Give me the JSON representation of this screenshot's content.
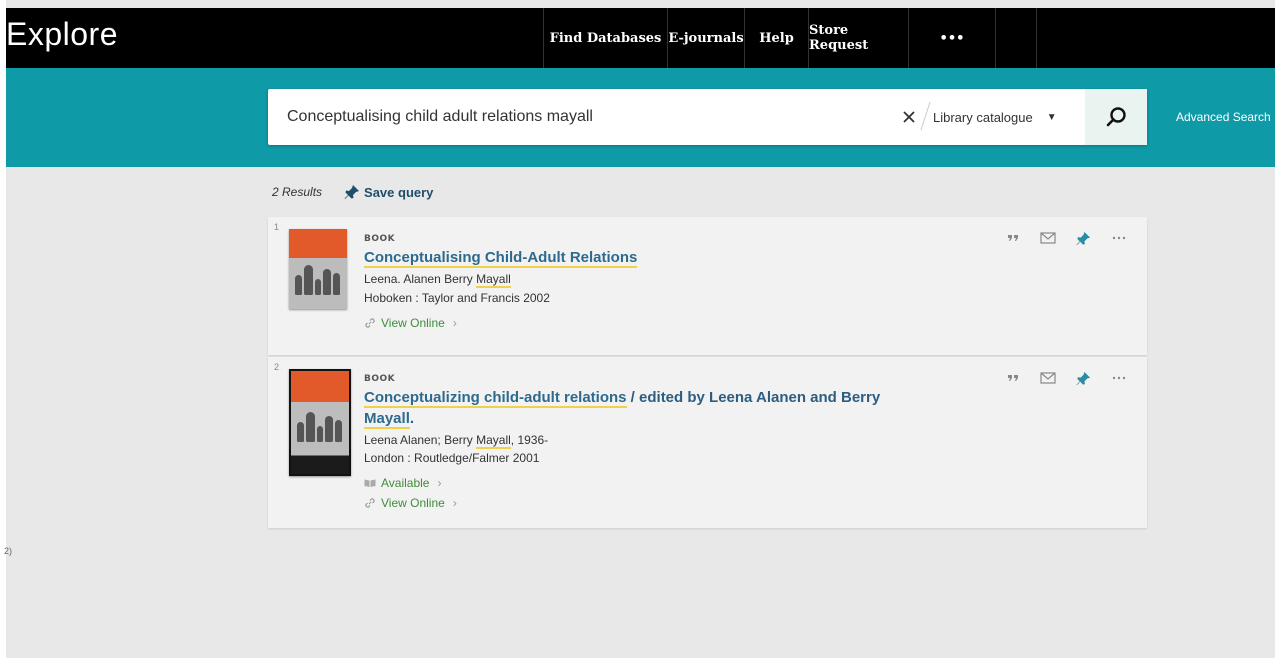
{
  "header": {
    "brand": "Explore",
    "nav": [
      "Find Databases",
      "E-journals",
      "Help",
      "Store Request",
      "•••"
    ]
  },
  "search": {
    "query": "Conceptualising child adult relations mayall",
    "placeholder": "",
    "scope": "Library catalogue",
    "advanced_label": "Advanced Search",
    "colors": {
      "bar": "#0f9aa8",
      "button_bg": "#e9f3ef"
    }
  },
  "results": {
    "count": "2 Results",
    "save_query": "Save query",
    "items": [
      {
        "number": "1",
        "type": "BOOK",
        "title_highlight": "Conceptualising Child-Adult Relations",
        "title_rest": "",
        "author_pre": "Leena. Alanen Berry",
        "author_hl": "Mayall",
        "author_post": "",
        "publisher": "Hoboken : Taylor and Francis 2002",
        "links": [
          "View Online"
        ]
      },
      {
        "number": "2",
        "type": "BOOK",
        "title_highlight": "Conceptualizing child-adult relations",
        "title_rest": " / edited by Leena Alanen and Berry ",
        "title_hl2": "Mayall",
        "title_end": ".",
        "author_pre": "Leena Alanen; Berry",
        "author_hl": "Mayall",
        "author_post": ", 1936-",
        "publisher": "London : Routledge/Falmer 2001",
        "links": [
          "Available",
          "View Online"
        ]
      }
    ]
  },
  "misc": {
    "stray_text": "2)"
  },
  "icons": [
    "close-icon",
    "caret-down-icon",
    "search-icon",
    "pin-icon",
    "quote-icon",
    "email-icon",
    "more-icon",
    "link-icon",
    "book-open-icon",
    "chevron-right-icon"
  ],
  "link_color": "#3e8d3b"
}
